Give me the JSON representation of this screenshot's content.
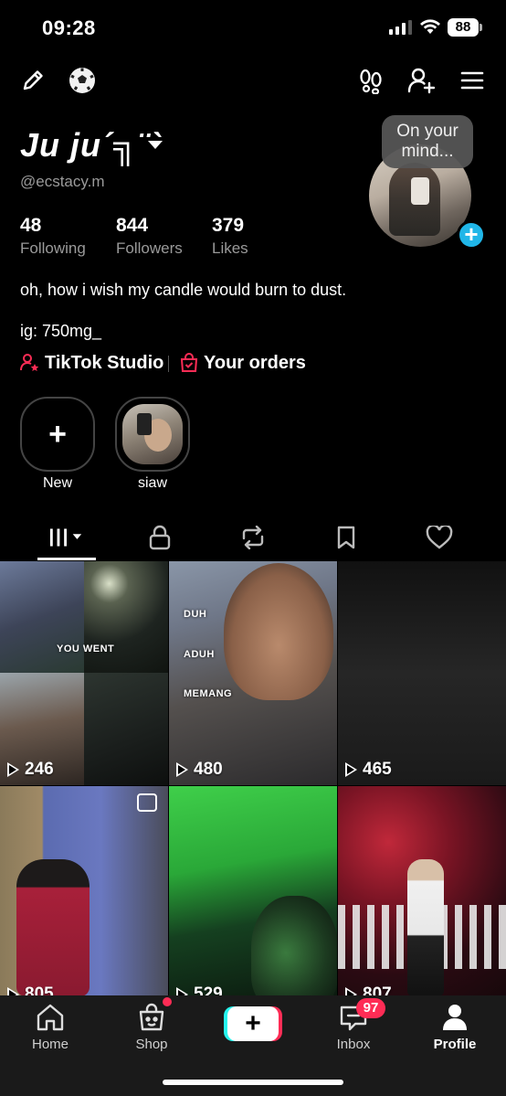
{
  "status_bar": {
    "time": "09:28",
    "battery": "88"
  },
  "profile": {
    "display_name": "Ju ju´╗¨`",
    "username": "@ecstacy.m",
    "stats": [
      {
        "value": "48",
        "label": "Following"
      },
      {
        "value": "844",
        "label": "Followers"
      },
      {
        "value": "379",
        "label": "Likes"
      }
    ],
    "mind_bubble": "On your mind...",
    "bio": "oh, how i wish my candle would burn to dust.",
    "ig": "ig: 750mg_",
    "links": {
      "studio": "TikTok Studio",
      "orders": "Your orders"
    }
  },
  "highlights": [
    {
      "label": "New"
    },
    {
      "label": "siaw"
    }
  ],
  "tabs": [
    "videos",
    "private",
    "reposts",
    "favorites",
    "liked"
  ],
  "videos": [
    {
      "views": "246",
      "caption": "YOU WENT"
    },
    {
      "views": "480",
      "captions": [
        "DUH",
        "ADUH",
        "MEMANG"
      ]
    },
    {
      "views": "465"
    },
    {
      "views": "805"
    },
    {
      "views": "529"
    },
    {
      "views": "807"
    }
  ],
  "bottom_nav": {
    "home": "Home",
    "shop": "Shop",
    "inbox": "Inbox",
    "inbox_badge": "97",
    "profile": "Profile"
  },
  "colors": {
    "accent_red": "#fe2c55",
    "accent_cyan": "#25f4ee",
    "plus_blue": "#20b6e8"
  }
}
